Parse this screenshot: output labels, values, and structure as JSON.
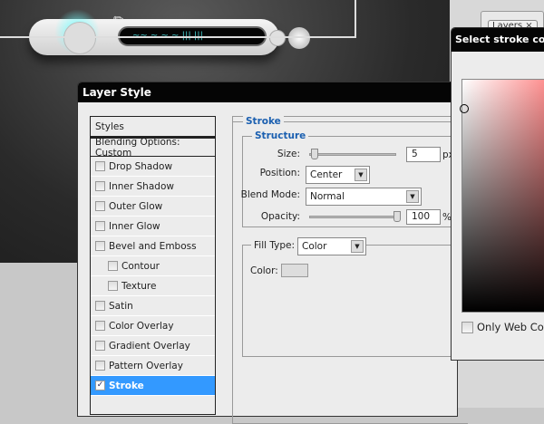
{
  "background": {
    "panel_tab": "Layers ×"
  },
  "player": {
    "screen_text": "~~ ~ ~ ~  ||| |||"
  },
  "layer_style": {
    "title": "Layer Style",
    "styles_header": "Styles",
    "blending": "Blending Options: Custom",
    "items": [
      {
        "label": "Drop Shadow",
        "checked": false,
        "sub": false
      },
      {
        "label": "Inner Shadow",
        "checked": false,
        "sub": false
      },
      {
        "label": "Outer Glow",
        "checked": false,
        "sub": false
      },
      {
        "label": "Inner Glow",
        "checked": false,
        "sub": false
      },
      {
        "label": "Bevel and Emboss",
        "checked": false,
        "sub": false
      },
      {
        "label": "Contour",
        "checked": false,
        "sub": true
      },
      {
        "label": "Texture",
        "checked": false,
        "sub": true
      },
      {
        "label": "Satin",
        "checked": false,
        "sub": false
      },
      {
        "label": "Color Overlay",
        "checked": false,
        "sub": false
      },
      {
        "label": "Gradient Overlay",
        "checked": false,
        "sub": false
      },
      {
        "label": "Pattern Overlay",
        "checked": false,
        "sub": false
      },
      {
        "label": "Stroke",
        "checked": true,
        "sub": false,
        "selected": true
      }
    ],
    "stroke": {
      "group": "Stroke",
      "structure": "Structure",
      "size_label": "Size:",
      "size": "5",
      "size_unit": "px",
      "size_value": 5,
      "position_label": "Position:",
      "position": "Center",
      "blend_label": "Blend Mode:",
      "blend": "Normal",
      "opacity_label": "Opacity:",
      "opacity": "100",
      "opacity_unit": "%",
      "opacity_value": 100,
      "fill_label": "Fill Type:",
      "fill": "Color",
      "color_label": "Color:",
      "color": "#dddddd"
    }
  },
  "picker": {
    "title": "Select stroke color:",
    "only_web": "Only Web Colors"
  }
}
